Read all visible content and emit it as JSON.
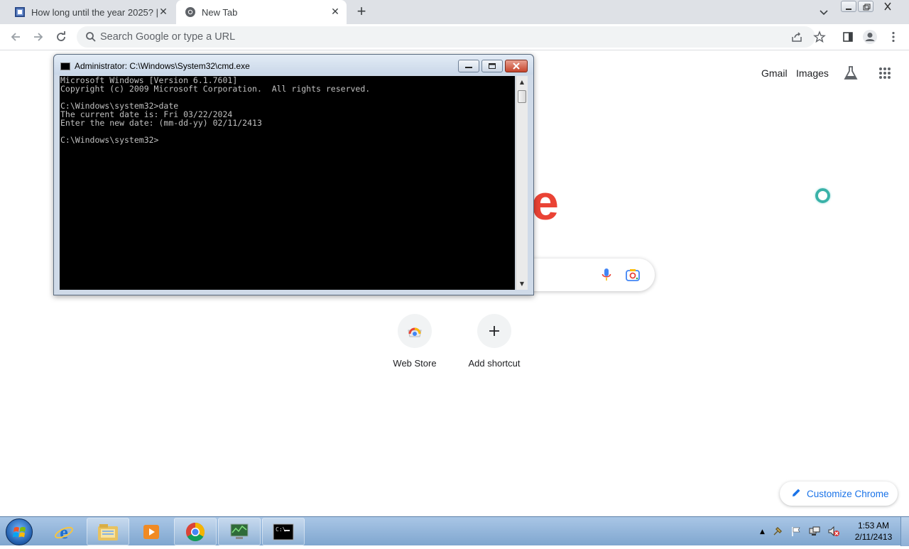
{
  "browser": {
    "tabs": [
      {
        "title": "How long until the year 2025? | H",
        "active": false
      },
      {
        "title": "New Tab",
        "active": true
      }
    ],
    "omnibox": {
      "placeholder": "Search Google or type a URL"
    }
  },
  "ntp": {
    "top_links": {
      "gmail": "Gmail",
      "images": "Images"
    },
    "logo_fragment": "e",
    "shortcuts": [
      {
        "label": "Web Store",
        "icon": "webstore-icon"
      },
      {
        "label": "Add shortcut",
        "icon": "plus-icon"
      }
    ],
    "customize_label": "Customize Chrome"
  },
  "cmd": {
    "title": "Administrator: C:\\Windows\\System32\\cmd.exe",
    "lines": [
      "Microsoft Windows [Version 6.1.7601]",
      "Copyright (c) 2009 Microsoft Corporation.  All rights reserved.",
      "",
      "C:\\Windows\\system32>date",
      "The current date is: Fri 03/22/2024",
      "Enter the new date: (mm-dd-yy) 02/11/2413",
      "",
      "C:\\Windows\\system32>"
    ]
  },
  "taskbar": {
    "apps": [
      "internet-explorer",
      "file-explorer",
      "media-player",
      "chrome",
      "network-monitor",
      "command-prompt"
    ],
    "clock": {
      "time": "1:53 AM",
      "date": "2/11/2413"
    }
  },
  "colors": {
    "accent": "#1a73e8",
    "google_red": "#ea4335",
    "tabstrip": "#dee1e6"
  }
}
